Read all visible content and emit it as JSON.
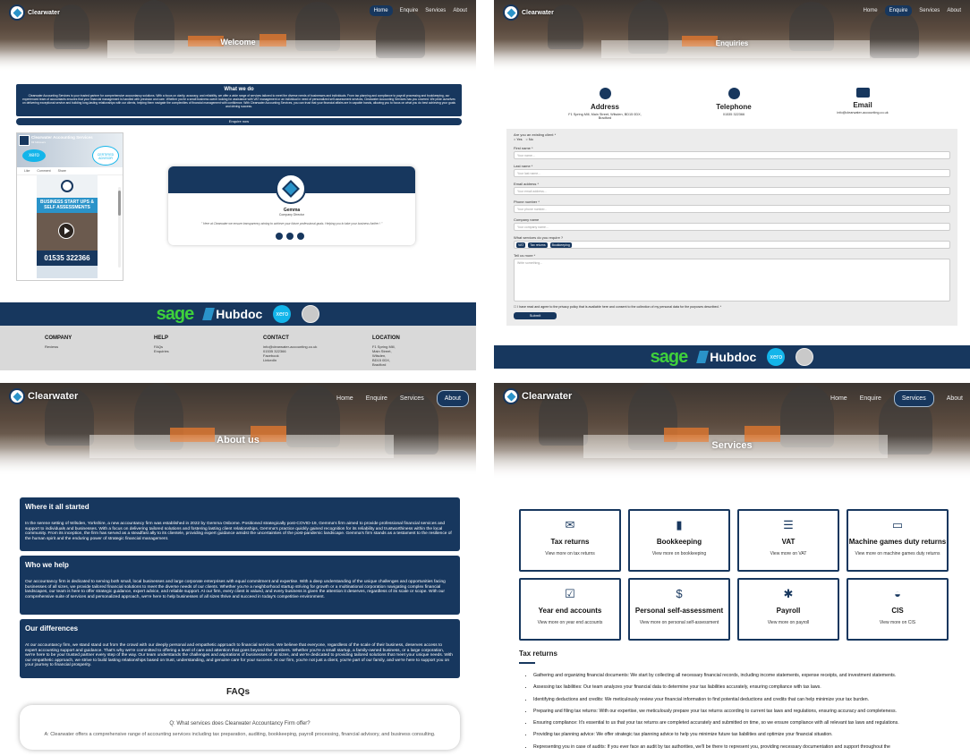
{
  "brand": "Clearwater",
  "colors": {
    "navy": "#17375e",
    "accent": "#2a93c9",
    "sage": "#3fd13b",
    "xero": "#13b5ea"
  },
  "nav": {
    "home": "Home",
    "enquire": "Enquire",
    "services": "Services",
    "about": "About"
  },
  "welcome": {
    "title": "Welcome",
    "what_we_do_title": "What we do",
    "what_we_do_text": "Clearwater Accounting Services is your trusted partner for comprehensive accountancy solutions. With a focus on clarity, accuracy, and reliability, we offer a wide range of services tailored to meet the diverse needs of businesses and individuals. From tax planning and compliance to payroll processing and bookkeeping, our experienced team of accountants ensures that your financial management is handled with precision and care. Whether you're a small business owner looking for assistance with VAT management or an individual in need of personalized self-assessment services, Clearwater Accounting Services has you covered. We pride ourselves on delivering exceptional service and building long-lasting relationships with our clients, helping them navigate the complexities of financial management with confidence. With Clearwater Accounting Services, you can trust that your financial affairs are in capable hands, allowing you to focus on what you do best achieving your goals and driving success.",
    "enquire_btn": "Enquire now",
    "social": {
      "page_name": "Clearwater Accounting Services",
      "likes": "93 followers",
      "xero_badge": "xero",
      "certified": "CERTIFIED ADVISOR",
      "tabs": [
        "Like",
        "Comment",
        "Share"
      ],
      "promo_title": "BUSINESS START UPS & SELF ASSESSMENTS",
      "promo_phone": "01535 322366"
    },
    "profile": {
      "name": "Gemma",
      "role": "Company Director",
      "quote": "\" Here at Clearwater we ensure transparency aiming to achieve your future professional goals. Helping you to take your business further ! \""
    }
  },
  "footer": {
    "company": {
      "title": "COMPANY",
      "items": [
        "Reviews"
      ]
    },
    "help": {
      "title": "HELP",
      "items": [
        "FAQs",
        "Enquiries"
      ]
    },
    "contact": {
      "title": "CONTACT",
      "items": [
        "info@clearwater-accounting.co.uk",
        "01535 322366",
        "Facebook",
        "LinkedIn"
      ]
    },
    "location": {
      "title": "LOCATION",
      "items": [
        "F1 Spring Mill,",
        "Main Street,",
        "Wilsden,",
        "BD15 0DX,",
        "Bradford"
      ]
    }
  },
  "partners": {
    "sage": "sage",
    "hubdoc": "Hubdoc",
    "xero": "xero"
  },
  "enquiries": {
    "title": "Enquiries",
    "address": {
      "title": "Address",
      "text": "F1 Spring Mill, Main Street, Wilsden, BD15 0DX, Bradford"
    },
    "telephone": {
      "title": "Telephone",
      "text": "01535 322366"
    },
    "email": {
      "title": "Email",
      "text": "info@clearwater-accounting.co.uk"
    },
    "form": {
      "existing_q": "Are you an existing client *",
      "yes": "Yes",
      "no": "No",
      "first_name": "First name *",
      "first_ph": "Your name...",
      "last_name": "Last name *",
      "last_ph": "Your last name...",
      "email_lbl": "Email address *",
      "email_ph": "Your email address...",
      "phone_lbl": "Phone number *",
      "phone_ph": "Your phone number...",
      "company_lbl": "Company name",
      "company_ph": "Your company name...",
      "services_lbl": "What services do you require ?",
      "chips": [
        "VAT",
        "Tax returns",
        "Bookkeeping"
      ],
      "more_lbl": "Tell us more *",
      "more_ph": "Write something...",
      "privacy": "I have read and agree to the privacy policy that is available here and consent to the collection of my personal data for the purposes described. *",
      "submit": "Submit"
    }
  },
  "about": {
    "title": "About us",
    "s1_title": "Where it all started",
    "s1_text": "In the serene setting of Wilsden, Yorkshire, a new accountancy firm was established in 2022 by Gemma Osborne. Positioned strategically post-COVID-19, Gemma's firm aimed to provide professional financial services and support to individuals and businesses. With a focus on delivering tailored solutions and fostering lasting client relationships, Gemma's practice quickly gained recognition for its reliability and trustworthiness within the local community. From its inception, the firm has served as a steadfast ally to its clientele, providing expert guidance amidst the uncertainties of the post-pandemic landscape. Gemma's firm stands as a testament to the resilience of the human spirit and the enduring power of strategic financial management.",
    "s2_title": "Who we help",
    "s2_text": "Our accountancy firm is dedicated to serving both small, local businesses and large corporate enterprises with equal commitment and expertise. With a deep understanding of the unique challenges and opportunities facing businesses of all sizes, we provide tailored financial solutions to meet the diverse needs of our clients. Whether you're a neighborhood startup striving for growth or a multinational corporation navigating complex financial landscapes, our team is here to offer strategic guidance, expert advice, and reliable support. At our firm, every client is valued, and every business is given the attention it deserves, regardless of its scale or scope. With our comprehensive suite of services and personalized approach, we're here to help businesses of all sizes thrive and succeed in today's competitive environment.",
    "s3_title": "Our differences",
    "s3_text": "At our accountancy firm, we stand stand out from the crowd with our deeply personal and empathetic approach to financial services. We believe that everyone, regardless of the scale of their business, deserves access to expert accounting support and guidance. That's why we're committed to offering a level of care and attention that goes beyond the numbers. Whether you're a small startup, a family-owned business, or a large corporation, we're here to be your trusted partner every step of the way. Our team understands the challenges and aspirations of businesses of all sizes, and we're dedicated to providing tailored solutions that meet your unique needs. With our empathetic approach, we strive to build lasting relationships based on trust, understanding, and genuine care for your success. At our firm, you're not just a client, you're part of our family, and we're here to support you on your journey to financial prosperity.",
    "faqs_title": "FAQs",
    "faq_q": "Q: What services does Clearwater Accountancy Firm offer?",
    "faq_a": "A: Clearwater offers a comprehensive range of accounting services including tax preparation, auditing, bookkeeping, payroll processing, financial advisory, and business consulting."
  },
  "services": {
    "title": "Services",
    "cards": [
      {
        "icon": "envelope-icon",
        "glyph": "✉",
        "title": "Tax returns",
        "sub": "View more on tax returns"
      },
      {
        "icon": "book-icon",
        "glyph": "▮",
        "title": "Bookkeeping",
        "sub": "View more on bookkeeping"
      },
      {
        "icon": "receipt-icon",
        "glyph": "☰",
        "title": "VAT",
        "sub": "View more on VAT"
      },
      {
        "icon": "monitor-icon",
        "glyph": "▭",
        "title": "Machine games duty returns",
        "sub": "View more on machine games duty returns"
      },
      {
        "icon": "calendar-check-icon",
        "glyph": "☑",
        "title": "Year end accounts",
        "sub": "View more on year end accounts"
      },
      {
        "icon": "user-dollar-icon",
        "glyph": "$",
        "title": "Personal self-assessment",
        "sub": "View more on personal self-assessment"
      },
      {
        "icon": "people-icon",
        "glyph": "✱",
        "title": "Payroll",
        "sub": "View more on payroll"
      },
      {
        "icon": "hardhat-icon",
        "glyph": "◒",
        "title": "CIS",
        "sub": "View more on CIS"
      }
    ],
    "tax_title": "Tax returns",
    "tax_items": [
      "Gathering and organizing financial documents: We start by collecting all necessary financial records, including income statements, expense receipts, and investment statements.",
      "Assessing tax liabilities: Our team analyzes your financial data to determine your tax liabilities accurately, ensuring compliance with tax laws.",
      "Identifying deductions and credits: We meticulously review your financial information to find potential deductions and credits that can help minimize your tax burden.",
      "Preparing and filing tax returns: With our expertise, we meticulously prepare your tax returns according to current tax laws and regulations, ensuring accuracy and completeness.",
      "Ensuring compliance: It's essential to us that your tax returns are completed accurately and submitted on time, so we ensure compliance with all relevant tax laws and regulations.",
      "Providing tax planning advice: We offer strategic tax planning advice to help you minimize future tax liabilities and optimize your financial situation.",
      "Representing you in case of audits: If you ever face an audit by tax authorities, we'll be there to represent you, providing necessary documentation and support throughout the"
    ]
  }
}
